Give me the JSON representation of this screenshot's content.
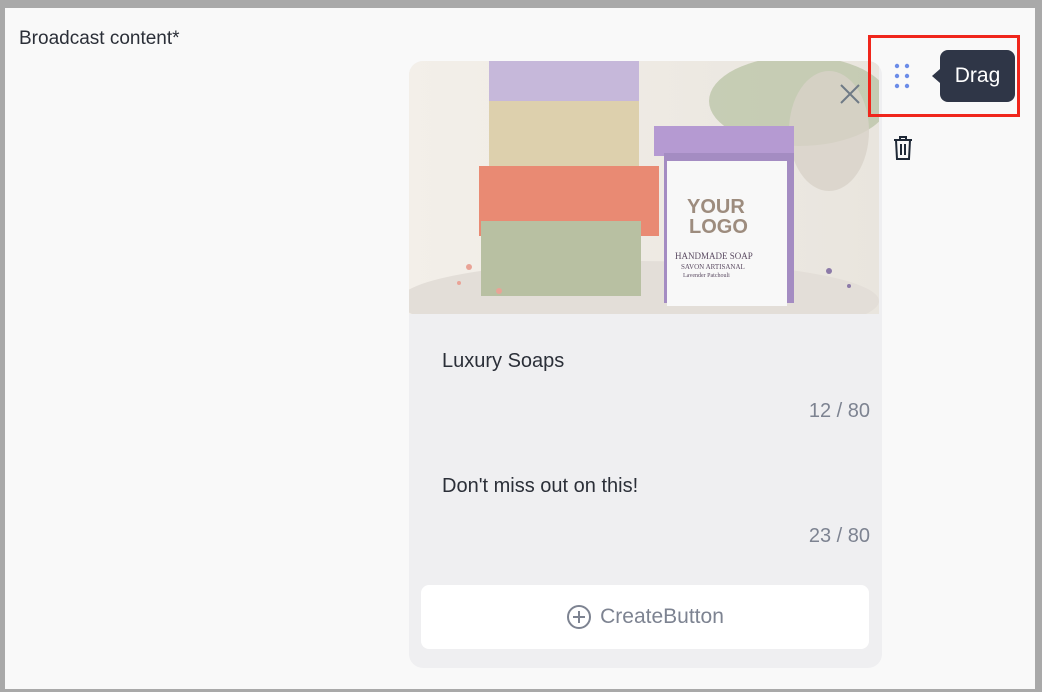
{
  "section": {
    "label": "Broadcast content*"
  },
  "card": {
    "image": {
      "logo_line1": "YOUR",
      "logo_line2": "LOGO",
      "label_line1": "HANDMADE SOAP",
      "label_line2": "SAVON ARTISANAL",
      "label_line3": "Lavender Patchouli"
    },
    "title": {
      "value": "Luxury Soaps",
      "count": "12 / 80"
    },
    "body": {
      "value": "Don't miss out on this!",
      "count": "23 / 80"
    },
    "create_button": {
      "label": "CreateButton"
    }
  },
  "tooltip": {
    "text": "Drag"
  },
  "colors": {
    "accent": "#6b8ce8",
    "tooltip_bg": "#2f3647",
    "highlight": "#f0261c"
  },
  "icons": [
    "close-icon",
    "drag-handle-icon",
    "trash-icon",
    "plus-circle-icon"
  ]
}
